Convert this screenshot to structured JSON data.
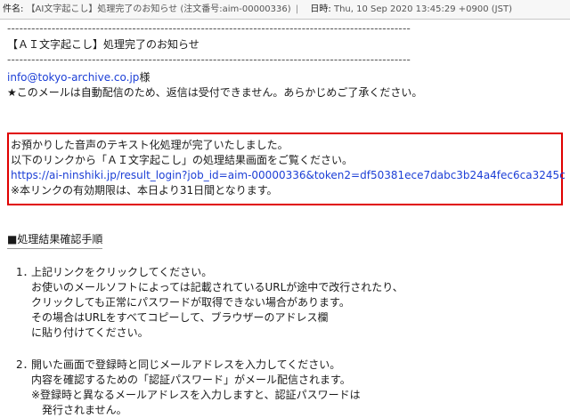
{
  "header": {
    "subject_label": "件名:",
    "subject": "【AI文字起こし】処理完了のお知らせ (注文番号:aim-00000336)",
    "date_label": "日時:",
    "date": "Thu, 10 Sep 2020 13:45:29 +0900 (JST)"
  },
  "body": {
    "dashes_top": "----------------------------------------------------------------------------------------------------",
    "title": "【ＡＩ文字起こし】処理完了のお知らせ",
    "dashes_bottom": "----------------------------------------------------------------------------------------------------",
    "recipient_email": "info@tokyo-archive.co.jp",
    "recipient_suffix": "様",
    "notice": "★このメールは自動配信のため、返信は受付できません。あらかじめご了承ください。",
    "box": {
      "line1": "お預かりした音声のテキスト化処理が完了いたしました。",
      "line2": "以下のリンクから「ＡＩ文字起こし」の処理結果画面をご覧ください。",
      "link": "https://ai-ninshiki.jp/result_login?job_id=aim-00000336&token2=df50381ece7dabc3b24a4fec6ca3245c",
      "line4": "※本リンクの有効期限は、本日より31日間となります。"
    },
    "section_title": "■処理結果確認手順",
    "step1": {
      "num": "1．",
      "line1": "上記リンクをクリックしてください。",
      "line2": "お使いのメールソフトによっては記載されているURLが途中で改行されたり、",
      "line3": "クリックしても正常にパスワードが取得できない場合があります。",
      "line4": "その場合はURLをすべてコピーして、ブラウザーのアドレス欄",
      "line5": "に貼り付けてください。"
    },
    "step2": {
      "num": "2．",
      "line1": "開いた画面で登録時と同じメールアドレスを入力してください。",
      "line2": "内容を確認するための「認証パスワード」がメール配信されます。",
      "line3": "※登録時と異なるメールアドレスを入力しますと、認証パスワードは",
      "line4": "発行されません。"
    }
  }
}
